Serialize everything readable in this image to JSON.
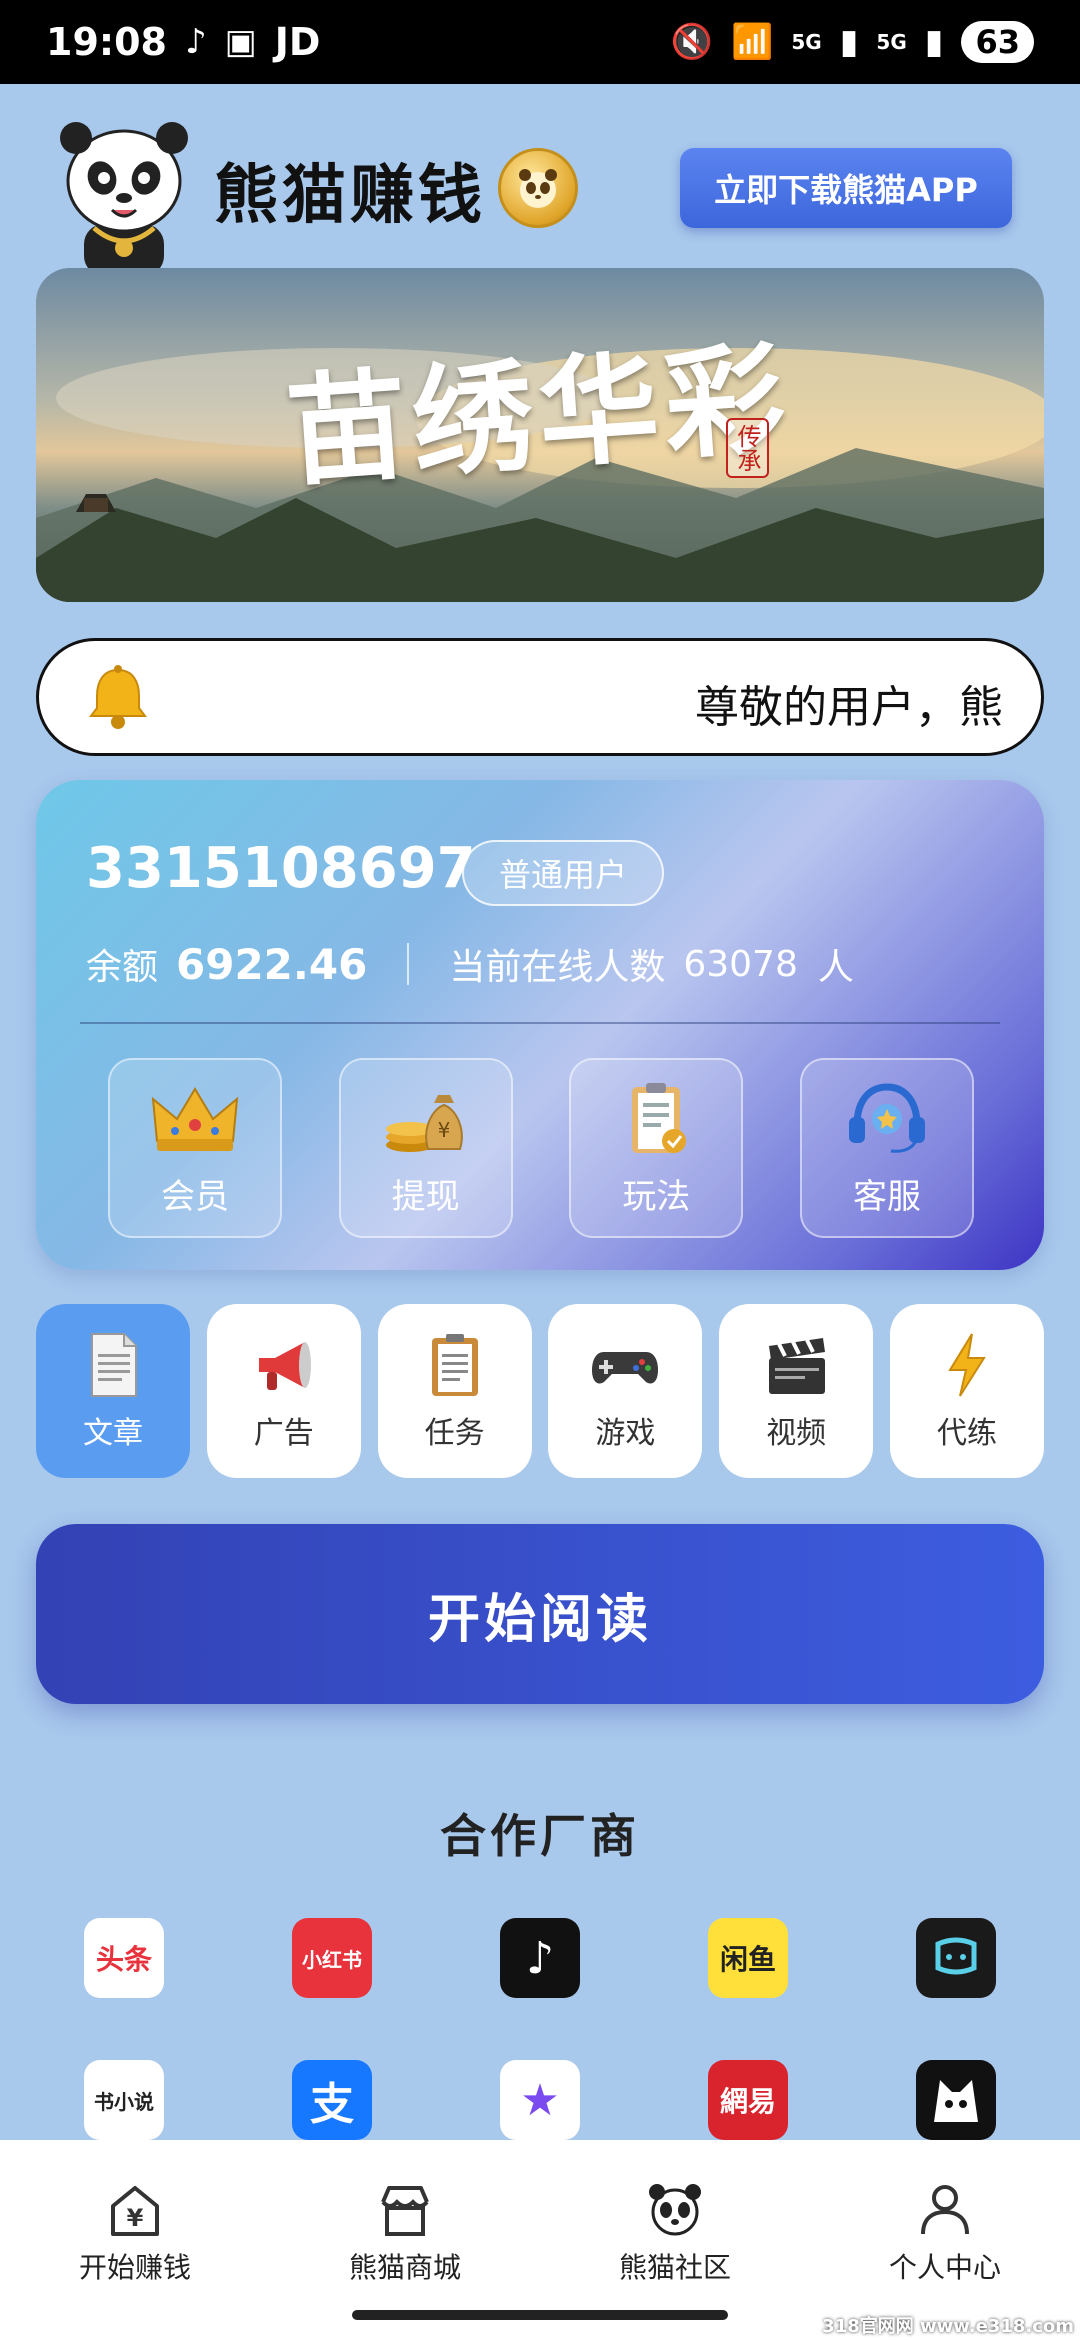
{
  "status_bar": {
    "time": "19:08",
    "app_label": "JD",
    "network_1": "5G",
    "network_2": "5G",
    "battery": "63"
  },
  "header": {
    "brand_title": "熊猫赚钱",
    "download_label": "立即下载熊猫APP"
  },
  "banner": {
    "title": "苗绣华彩",
    "seal": "传承"
  },
  "notice": {
    "text": "尊敬的用户，熊"
  },
  "account": {
    "user_id": "3315108697",
    "badge": "普通用户",
    "balance_label": "余额",
    "balance_value": "6922.46",
    "online_label": "当前在线人数",
    "online_value": "63078",
    "online_unit": "人",
    "actions": [
      {
        "label": "会员",
        "icon": "crown-icon"
      },
      {
        "label": "提现",
        "icon": "money-bag-icon"
      },
      {
        "label": "玩法",
        "icon": "clipboard-icon"
      },
      {
        "label": "客服",
        "icon": "headset-icon"
      }
    ]
  },
  "categories": [
    {
      "label": "文章",
      "icon": "document-icon",
      "active": true
    },
    {
      "label": "广告",
      "icon": "megaphone-icon",
      "active": false
    },
    {
      "label": "任务",
      "icon": "task-clipboard-icon",
      "active": false
    },
    {
      "label": "游戏",
      "icon": "gamepad-icon",
      "active": false
    },
    {
      "label": "视频",
      "icon": "clapperboard-icon",
      "active": false
    },
    {
      "label": "代练",
      "icon": "lightning-icon",
      "active": false
    }
  ],
  "start_button": "开始阅读",
  "partners": {
    "title": "合作厂商",
    "logos": [
      {
        "name": "toutiao-logo",
        "text": "头条",
        "bg": "#ffffff",
        "fg": "#e8323c"
      },
      {
        "name": "xiaohongshu-logo",
        "text": "小红书",
        "bg": "#e8323c",
        "fg": "#ffffff"
      },
      {
        "name": "douyin-logo",
        "text": "♪",
        "bg": "#111111",
        "fg": "#ffffff"
      },
      {
        "name": "xianyu-logo",
        "text": "闲鱼",
        "bg": "#ffe03a",
        "fg": "#222222"
      },
      {
        "name": "app-logo-5",
        "text": "",
        "bg": "#1a1a1a",
        "fg": "#5ad0e8"
      },
      {
        "name": "shuqi-logo",
        "text": "书小说",
        "bg": "#ffffff",
        "fg": "#222222"
      },
      {
        "name": "alipay-logo",
        "text": "支",
        "bg": "#1677ff",
        "fg": "#ffffff"
      },
      {
        "name": "star-app-logo",
        "text": "★",
        "bg": "#ffffff",
        "fg": "#7c4bf0"
      },
      {
        "name": "netease-logo",
        "text": "網易",
        "bg": "#d9232d",
        "fg": "#ffffff"
      },
      {
        "name": "cat-app-logo",
        "text": "",
        "bg": "#111111",
        "fg": "#ffffff"
      }
    ]
  },
  "bottom_nav": [
    {
      "label": "开始赚钱",
      "icon": "yen-house-icon"
    },
    {
      "label": "熊猫商城",
      "icon": "store-icon"
    },
    {
      "label": "熊猫社区",
      "icon": "panda-icon"
    },
    {
      "label": "个人中心",
      "icon": "person-icon"
    }
  ],
  "watermark": "318官网网 www.e318.com"
}
